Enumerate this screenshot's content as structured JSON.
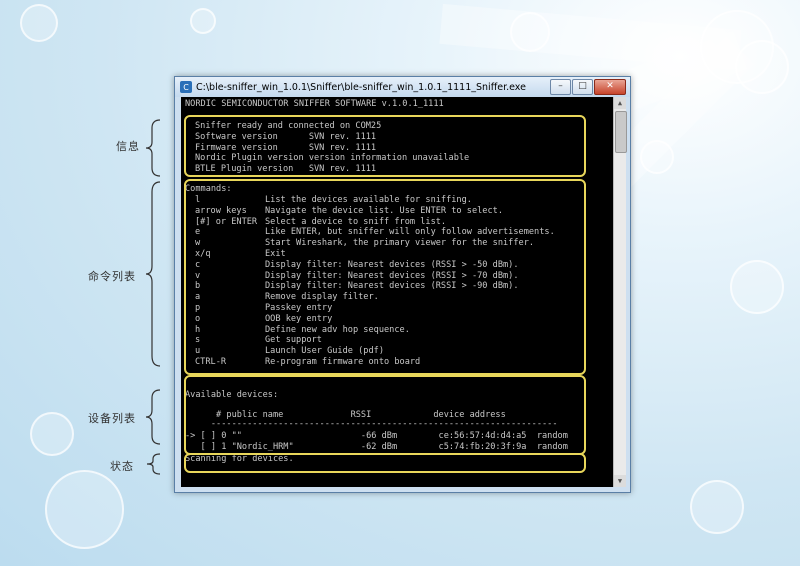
{
  "window": {
    "title": "C:\\ble-sniffer_win_1.0.1\\Sniffer\\ble-sniffer_win_1.0.1_1111_Sniffer.exe",
    "minimize": "–",
    "maximize": "□",
    "close": "✕"
  },
  "console": {
    "header": "NORDIC SEMICONDUCTOR SNIFFER SOFTWARE v.1.0.1_1111",
    "info": [
      "Sniffer ready and connected on COM25",
      "Software version      SVN rev. 1111",
      "Firmware version      SVN rev. 1111",
      "Nordic Plugin version version information unavailable",
      "BTLE Plugin version   SVN rev. 1111"
    ],
    "commands_title": "Commands:",
    "commands": [
      {
        "key": "l",
        "desc": "List the devices available for sniffing."
      },
      {
        "key": "arrow keys",
        "desc": "Navigate the device list. Use ENTER to select."
      },
      {
        "key": "[#] or ENTER",
        "desc": "Select a device to sniff from list."
      },
      {
        "key": "e",
        "desc": "Like ENTER, but sniffer will only follow advertisements."
      },
      {
        "key": "w",
        "desc": "Start Wireshark, the primary viewer for the sniffer."
      },
      {
        "key": "x/q",
        "desc": "Exit"
      },
      {
        "key": "c",
        "desc": "Display filter: Nearest devices (RSSI > -50 dBm)."
      },
      {
        "key": "v",
        "desc": "Display filter: Nearest devices (RSSI > -70 dBm)."
      },
      {
        "key": "b",
        "desc": "Display filter: Nearest devices (RSSI > -90 dBm)."
      },
      {
        "key": "a",
        "desc": "Remove display filter."
      },
      {
        "key": "p",
        "desc": "Passkey entry"
      },
      {
        "key": "o",
        "desc": "OOB key entry"
      },
      {
        "key": "h",
        "desc": "Define new adv hop sequence."
      },
      {
        "key": "s",
        "desc": "Get support"
      },
      {
        "key": "u",
        "desc": "Launch User Guide (pdf)"
      },
      {
        "key": "CTRL-R",
        "desc": "Re-program firmware onto board"
      }
    ],
    "devices_title": "Available devices:",
    "devices_header": "      # public name             RSSI            device address",
    "devices_rule": "     -------------------------------------------------------------------",
    "devices": [
      "-> [ ] 0 \"\"                       -66 dBm        ce:56:57:4d:d4:a5  random",
      "   [ ] 1 \"Nordic_HRM\"             -62 dBm        c5:74:fb:20:3f:9a  random"
    ],
    "status": "Scanning for devices."
  },
  "annotations": {
    "info": "信息",
    "commands": "命令列表",
    "devices": "设备列表",
    "status": "状态"
  },
  "colors": {
    "highlight": "#e8d65a",
    "console_bg": "#000000",
    "console_text": "#c8c8c8"
  }
}
